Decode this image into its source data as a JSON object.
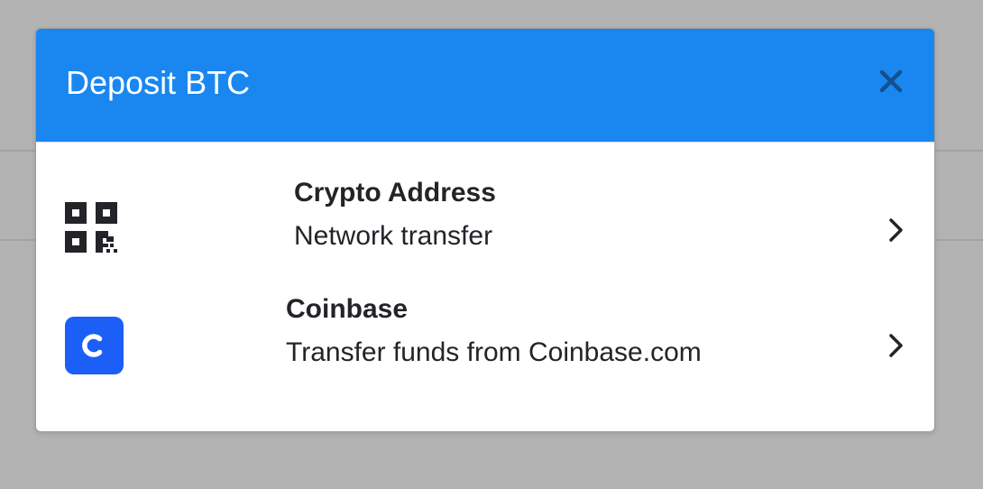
{
  "modal": {
    "title": "Deposit BTC",
    "close_icon": "close-icon",
    "header_color": "#1a87f0"
  },
  "options": [
    {
      "icon": "qr-code-icon",
      "title": "Crypto Address",
      "subtitle": "Network transfer"
    },
    {
      "icon": "coinbase-logo-icon",
      "logo_letter": "C",
      "logo_color": "#1b5ff6",
      "title": "Coinbase",
      "subtitle": "Transfer funds from Coinbase.com"
    }
  ]
}
